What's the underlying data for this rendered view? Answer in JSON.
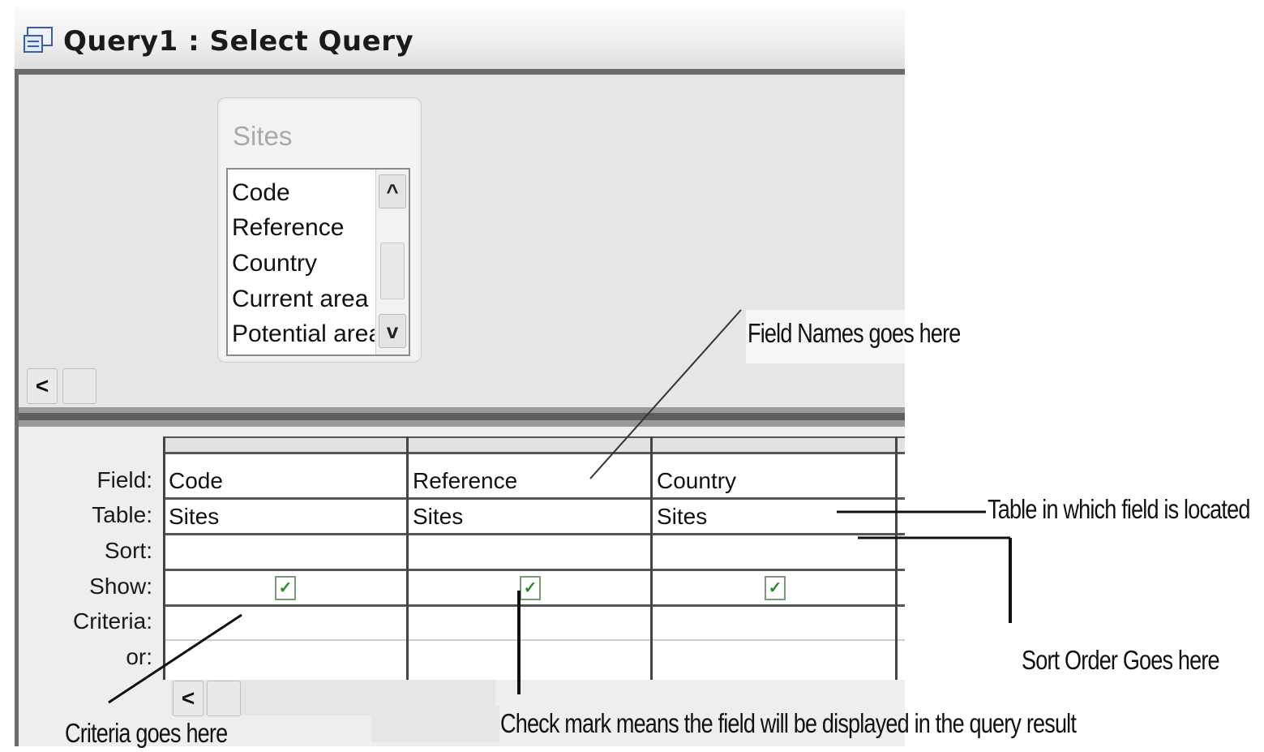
{
  "window": {
    "title": "Query1 : Select Query"
  },
  "field_list": {
    "table_name": "Sites",
    "fields": [
      "Code",
      "Reference",
      "Country",
      "Current area",
      "Potential area"
    ]
  },
  "grid": {
    "row_labels": [
      "Field:",
      "Table:",
      "Sort:",
      "Show:",
      "Criteria:",
      "or:"
    ],
    "columns": [
      {
        "field": "Code",
        "table": "Sites",
        "sort": "",
        "show": true,
        "criteria": "",
        "or": ""
      },
      {
        "field": "Reference",
        "table": "Sites",
        "sort": "",
        "show": true,
        "criteria": "",
        "or": ""
      },
      {
        "field": "Country",
        "table": "Sites",
        "sort": "",
        "show": true,
        "criteria": "",
        "or": ""
      }
    ]
  },
  "annotations": {
    "field_names": "Field Names goes here",
    "table_location": "Table in which field is located",
    "sort_order": "Sort Order Goes here",
    "criteria": "Criteria goes here",
    "check_mark": "Check mark means the field will be displayed in the query result"
  },
  "icons": {
    "scroll_up": "^",
    "scroll_down": "v",
    "scroll_left": "<",
    "check": "✓"
  }
}
